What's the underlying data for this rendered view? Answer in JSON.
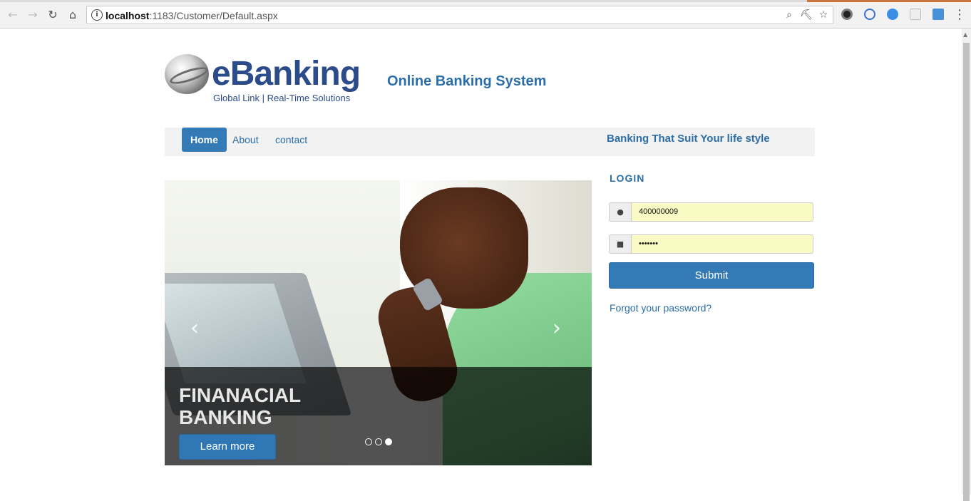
{
  "browser": {
    "url_host": "localhost",
    "url_path": ":1183/Customer/Default.aspx",
    "back_icon": "back-arrow-icon",
    "forward_icon": "forward-arrow-icon",
    "reload_icon": "reload-icon",
    "home_icon": "home-icon",
    "zoom_icon": "zoom-icon",
    "key_icon": "key-icon",
    "star_icon": "bookmark-star-icon",
    "menu_icon": "kebab-menu-icon"
  },
  "brand": {
    "logo_text": "eBanking",
    "logo_tagline": "Global Link | Real-Time Solutions",
    "site_title": "Online Banking System"
  },
  "nav": {
    "items": [
      {
        "label": "Home",
        "active": true
      },
      {
        "label": "About",
        "active": false
      },
      {
        "label": "contact",
        "active": false
      }
    ],
    "tagline": "Banking That Suit Your life style"
  },
  "carousel": {
    "caption_title": "FINANACIAL BANKING",
    "button_label": "Learn more",
    "slide_count": 3,
    "active_slide": 3
  },
  "login": {
    "heading": "LOGIN",
    "username_value": "400000009",
    "password_value": "•••••••",
    "submit_label": "Submit",
    "forgot_label": "Forgot your password?"
  },
  "colors": {
    "primary": "#337ab7",
    "link": "#2b6ea8",
    "autofill": "#fafbc4"
  }
}
